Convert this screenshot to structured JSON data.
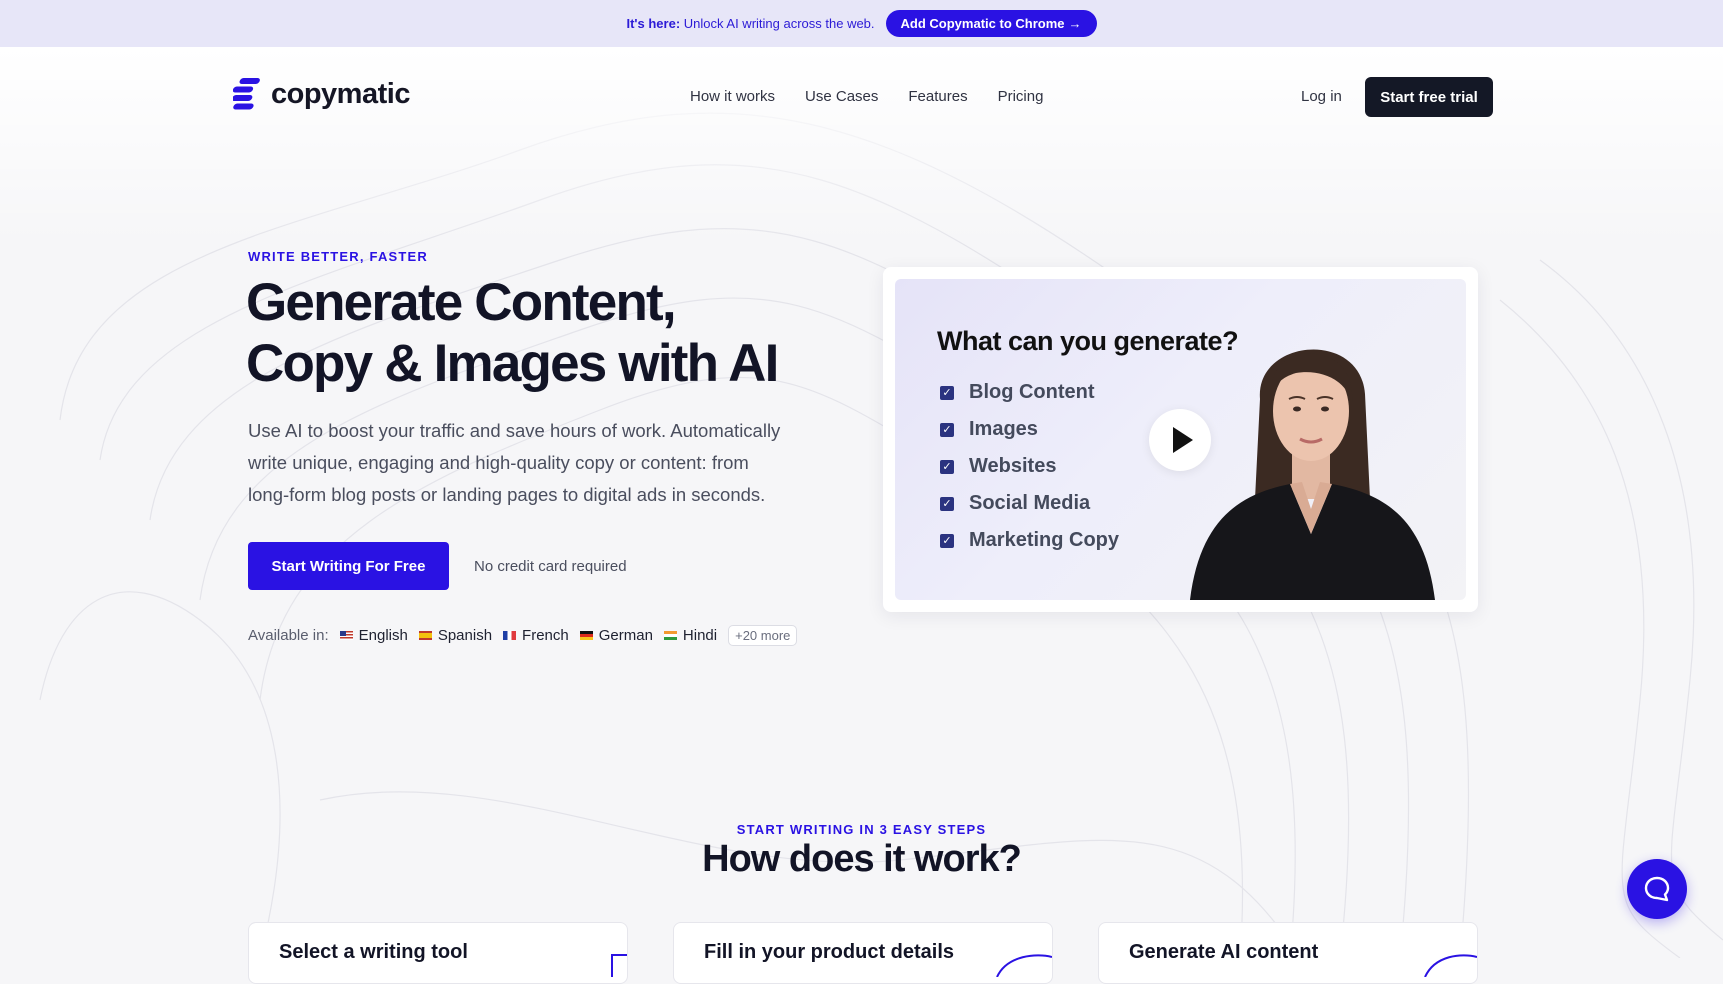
{
  "announcement": {
    "lead": "It's here:",
    "text": "Unlock AI writing across the web.",
    "button": "Add Copymatic to Chrome",
    "button_arrow": "→"
  },
  "nav": {
    "logo": "copymatic",
    "links": [
      "How it works",
      "Use Cases",
      "Features",
      "Pricing"
    ],
    "login": "Log in",
    "cta": "Start free trial"
  },
  "hero": {
    "eyebrow": "WRITE BETTER, FASTER",
    "title_line1": "Generate Content,",
    "title_line2": "Copy & Images with AI",
    "description": "Use AI to boost your traffic and save hours of work. Automatically write unique, engaging and high-quality copy or content: from long-form blog posts or landing pages to digital ads in seconds.",
    "cta": "Start Writing For Free",
    "note": "No credit card required",
    "available_label": "Available in:",
    "languages": [
      "English",
      "Spanish",
      "French",
      "German",
      "Hindi"
    ],
    "more": "+20 more"
  },
  "video": {
    "heading": "What can you generate?",
    "items": [
      "Blog Content",
      "Images",
      "Websites",
      "Social Media",
      "Marketing Copy"
    ]
  },
  "how": {
    "eyebrow": "START WRITING IN 3 EASY STEPS",
    "title": "How does it work?",
    "steps": [
      "Select a writing tool",
      "Fill in your product details",
      "Generate AI content"
    ]
  },
  "colors": {
    "brand": "#2a12e3",
    "dark": "#141826",
    "announce_bg": "#e7e6f8"
  },
  "icons": {
    "play": "play-icon",
    "chat": "chat-bubble-icon",
    "check": "checkbox-checked-icon"
  }
}
